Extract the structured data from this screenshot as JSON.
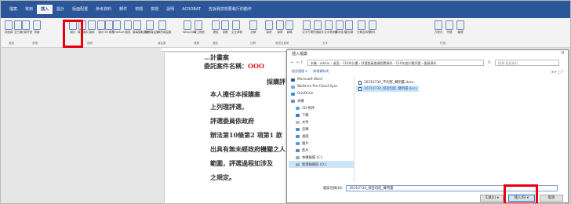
{
  "ribbon_tabs": [
    "檔案",
    "常用",
    "插入",
    "設計",
    "版面配置",
    "參考資料",
    "郵件",
    "校閱",
    "檢視",
    "說明",
    "ACROBAT",
    "告訴我您想要執行的動作"
  ],
  "ribbon_buttons": [
    "封面頁",
    "空白頁",
    "分頁符號",
    "表格",
    "圖片",
    "線上圖片",
    "圖案",
    "圖示",
    "3D 模型",
    "SmartArt",
    "圖表",
    "螢幕擷取畫面",
    "取得增益集",
    "我的增益集",
    "Wikipedia",
    "線上視訊",
    "連結",
    "書籤",
    "交互參照",
    "註解",
    "頁首",
    "頁尾",
    "頁碼",
    "文字方塊",
    "快速組件",
    "文字藝術師",
    "首字放大",
    "簽名欄",
    "日期及時間",
    "物件",
    "方程式",
    "符號",
    "編號"
  ],
  "ribbon_groups": [
    "頁面",
    "表格",
    "圖例",
    "增益集",
    "媒體",
    "連結",
    "註解",
    "頁首及頁尾",
    "文字",
    "符號"
  ],
  "document_lines": [
    {
      "text": "…計畫案",
      "red": ""
    },
    {
      "text": "委託案件名稱：",
      "red": "OOO"
    },
    {
      "text": "　　　　　　　　　　採購評",
      "red": ""
    },
    {
      "text": "　本人擔任本採購案",
      "red": ""
    },
    {
      "text": "上列理評選，",
      "red": ""
    },
    {
      "text": "　評選委員依政府",
      "red": ""
    },
    {
      "text": "辦法第10條第2 項第1 款",
      "red": ""
    },
    {
      "text": "出具有無未經政府機關之人",
      "red": ""
    },
    {
      "text": "範圍，評選過程如涉及",
      "red": ""
    },
    {
      "text": "之規定。",
      "red": ""
    }
  ],
  "dialog": {
    "title": "插入檔案",
    "close": "✕",
    "nav_arrows": "←  →  ↑",
    "path": "本機 › admin › 桌面 › 110年計畫 › 評選委員會議相關資料 › 110年度計畫評選 › 委員資料",
    "search_placeholder": "搜尋 委員資料",
    "tools": [
      "組合管理 ▾",
      "新增資料夾"
    ],
    "view_controls": "☰ ▾   ▢   ?",
    "nav_items": [
      {
        "label": "Microsoft Word",
        "sub": false,
        "color": "#2b579a"
      },
      {
        "label": "WeDrive Pro Cloud Sync",
        "sub": false,
        "color": "#7aa7d8"
      },
      {
        "label": "OneDrive",
        "sub": false,
        "color": "#3b8fd8"
      },
      {
        "label": "本機",
        "sub": false,
        "color": "#6a8fc0"
      },
      {
        "label": "3D 物件",
        "sub": true,
        "color": "#58a6d8"
      },
      {
        "label": "下載",
        "sub": true,
        "color": "#2f7fd3"
      },
      {
        "label": "文件",
        "sub": true,
        "color": "#b7b7b7"
      },
      {
        "label": "音樂",
        "sub": true,
        "color": "#3b8fd8"
      },
      {
        "label": "桌面",
        "sub": true,
        "color": "#4a8fd8"
      },
      {
        "label": "圖片",
        "sub": true,
        "color": "#4aa0e0"
      },
      {
        "label": "影片",
        "sub": true,
        "color": "#6a7fb8"
      },
      {
        "label": "本機磁碟 (C:)",
        "sub": true,
        "color": "#9aa"
      },
      {
        "label": "新增磁碟區 (D:)",
        "sub": true,
        "color": "#9aa",
        "sel": true
      }
    ],
    "files": [
      {
        "name": "20210730_不利害_聲明書.docx",
        "sel": false
      },
      {
        "name": "20210730_保密切結_聲明書.docx",
        "sel": true
      }
    ],
    "filename_label": "檔案名稱(N):",
    "filename_value": "20210730_保密切結_聲明書",
    "tools_btn": "工具(L) ▾",
    "insert_btn": "插入(S) ▾",
    "cancel_btn": "取消"
  }
}
